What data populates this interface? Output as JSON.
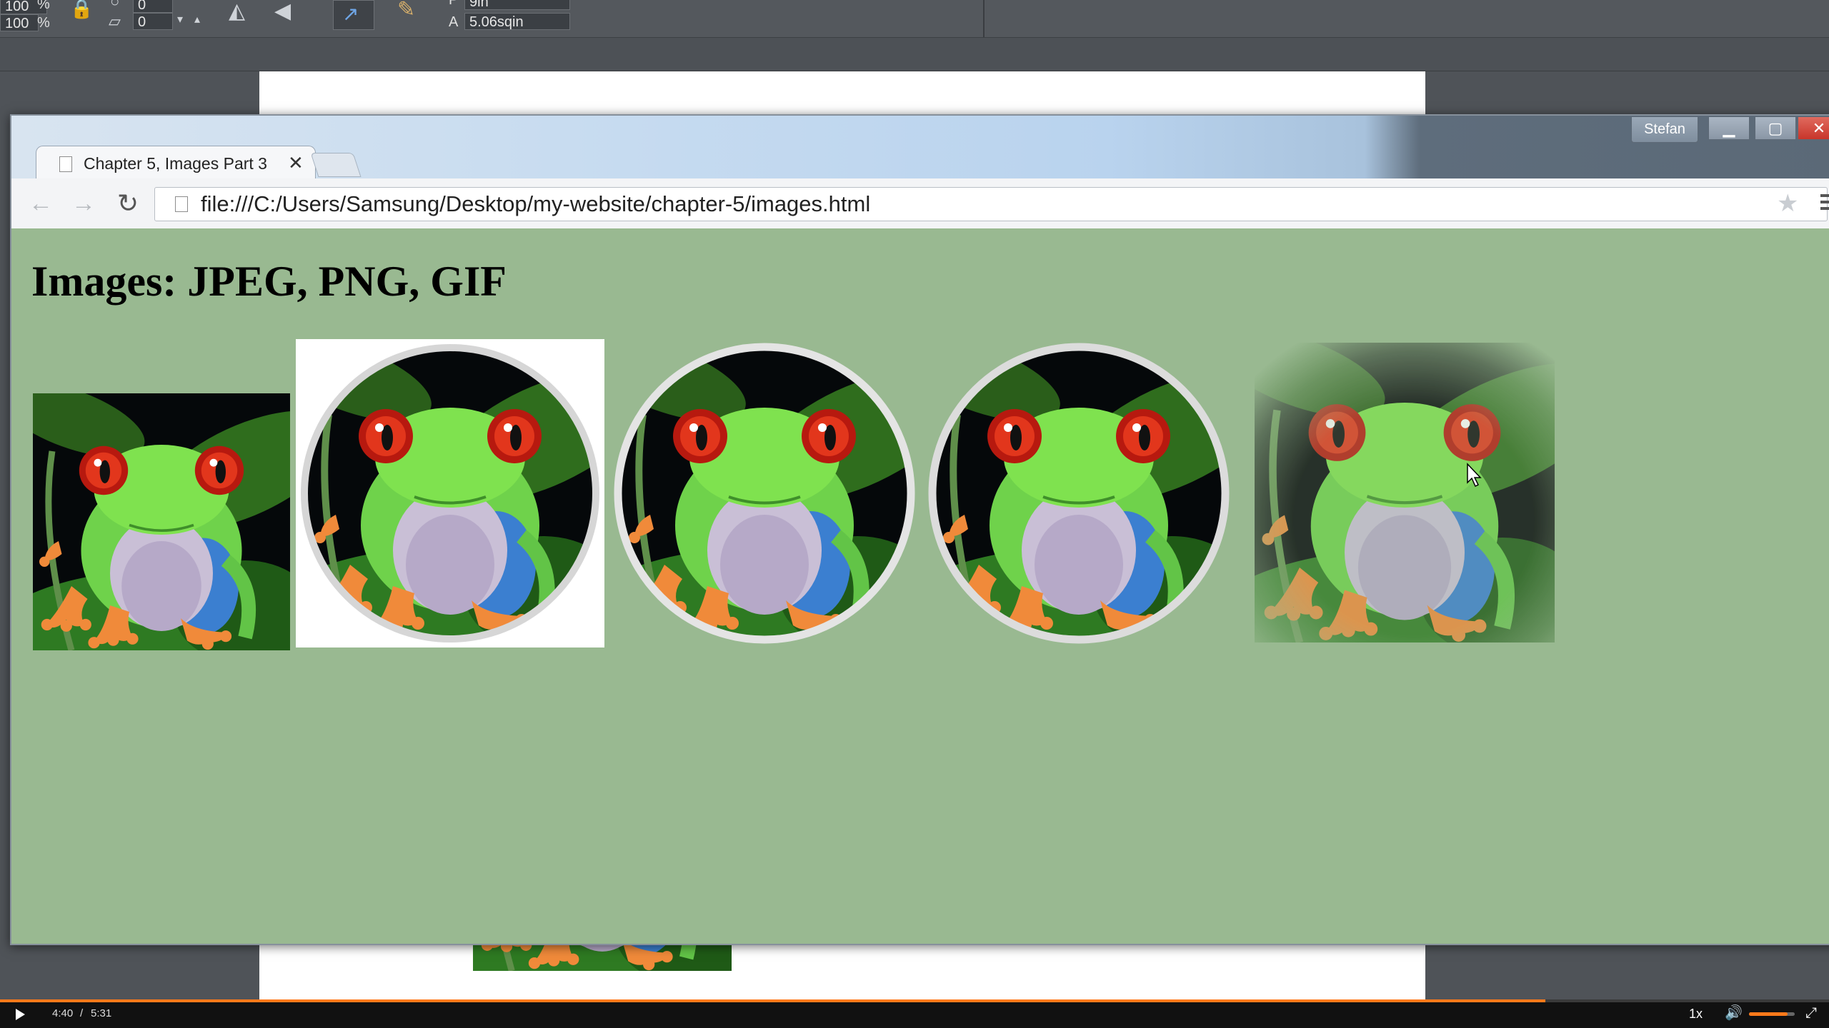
{
  "design_app": {
    "toolbar": {
      "scale_w": "100",
      "scale_h": "100",
      "percent_unit": "%",
      "rotation_value": "0",
      "skew_value": "0",
      "p_label": "P",
      "p_value": "9in",
      "a_label": "A",
      "a_value": "5.06sqin"
    }
  },
  "browser": {
    "user_name": "Stefan",
    "tab": {
      "title": "Chapter 5, Images Part 3",
      "close": "✕"
    },
    "address": "file:///C:/Users/Samsung/Desktop/my-website/chapter-5/images.html",
    "page": {
      "heading": "Images: JPEG, PNG, GIF",
      "background_color": "#99b991",
      "images": [
        {
          "name": "frog-jpeg-square",
          "shape": "square"
        },
        {
          "name": "frog-png-circle-white-bg",
          "shape": "circle on white"
        },
        {
          "name": "frog-png-circle",
          "shape": "circle"
        },
        {
          "name": "frog-gif-circle",
          "shape": "circle"
        },
        {
          "name": "frog-png-feathered",
          "shape": "feathered circle"
        }
      ]
    }
  },
  "player": {
    "current_time": "4:40",
    "separator": "/",
    "duration": "5:31",
    "speed": "1x",
    "progress_fraction": 0.845,
    "volume_fraction": 0.85,
    "accent_color": "#ff7a1a"
  }
}
